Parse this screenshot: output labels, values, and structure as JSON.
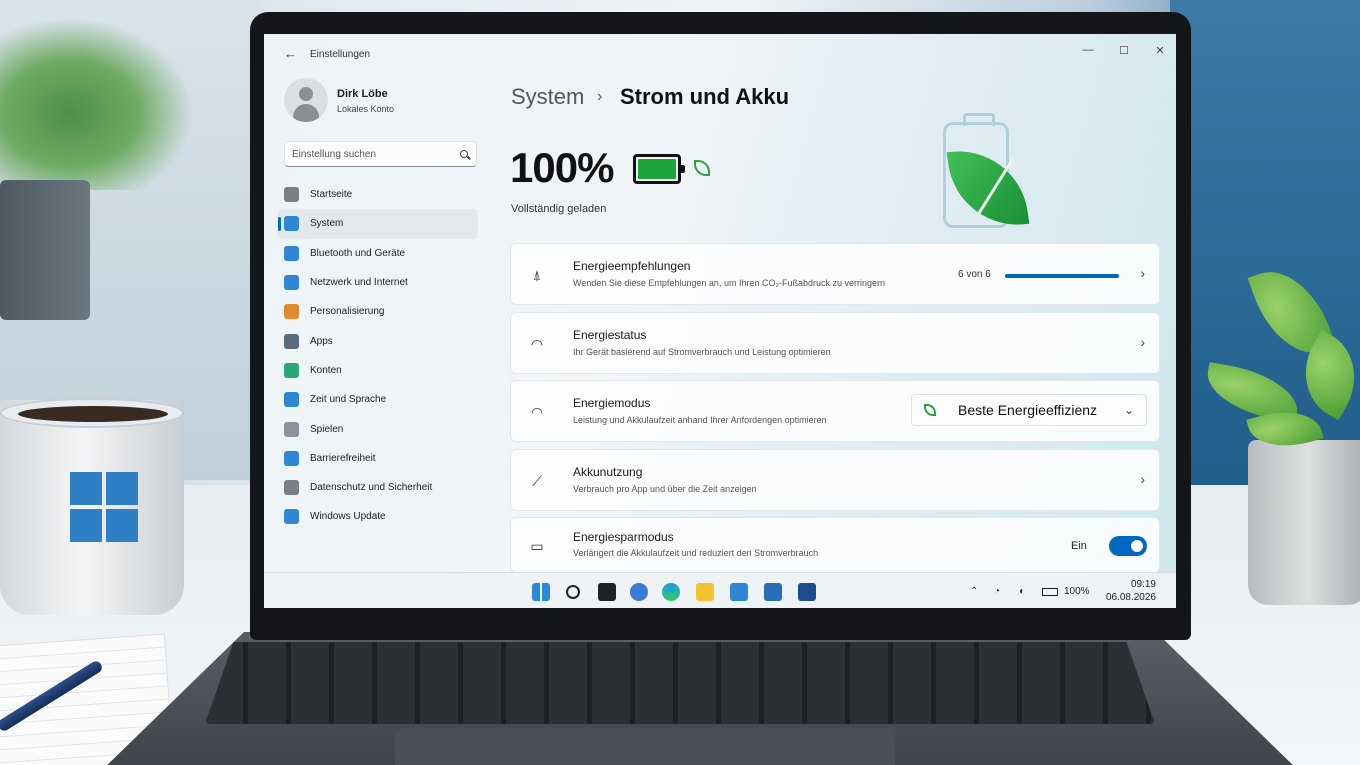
{
  "window": {
    "title": "Einstellungen",
    "back": "←",
    "controls": [
      "—",
      "☐",
      "✕"
    ]
  },
  "user": {
    "name": "Dirk Löbe",
    "account": "Lokales Konto"
  },
  "search": {
    "placeholder": "Einstellung suchen"
  },
  "nav": [
    {
      "label": "Startseite",
      "icon": "home-icon",
      "color": "#7a7f85",
      "active": false
    },
    {
      "label": "System",
      "icon": "system-icon",
      "color": "#2f87d4",
      "active": true
    },
    {
      "label": "Bluetooth und Geräte",
      "icon": "bluetooth-icon",
      "color": "#2f87d4",
      "active": false
    },
    {
      "label": "Netzwerk und Internet",
      "icon": "wifi-icon",
      "color": "#2f87d4",
      "active": false
    },
    {
      "label": "Personalisierung",
      "icon": "brush-icon",
      "color": "#e08a2e",
      "active": false
    },
    {
      "label": "Apps",
      "icon": "apps-icon",
      "color": "#5b6b7e",
      "active": false
    },
    {
      "label": "Konten",
      "icon": "person-icon",
      "color": "#2ba776",
      "active": false
    },
    {
      "label": "Zeit und Sprache",
      "icon": "globe-icon",
      "color": "#2f87d4",
      "active": false
    },
    {
      "label": "Spielen",
      "icon": "gamepad-icon",
      "color": "#8a929b",
      "active": false
    },
    {
      "label": "Barrierefreiheit",
      "icon": "accessibility-icon",
      "color": "#2f87d4",
      "active": false
    },
    {
      "label": "Datenschutz und Sicherheit",
      "icon": "shield-icon",
      "color": "#7a7f85",
      "active": false
    },
    {
      "label": "Windows Update",
      "icon": "update-icon",
      "color": "#2f87d4",
      "active": false
    }
  ],
  "breadcrumb": {
    "parent": "System",
    "separator": "›",
    "current": "Strom und Akku"
  },
  "battery": {
    "percent": "100%",
    "level": 1.0,
    "status": "Vollständig geladen",
    "color": "#1fa33b"
  },
  "cards": {
    "recommendations": {
      "title": "Energieempfehlungen",
      "subtitle": "Wenden Sie diese Empfehlungen an, um Ihren CO₂-Fußabdruck zu verringern",
      "progress_label": "6 von 6",
      "progress": 1.0
    },
    "status": {
      "title": "Energiestatus",
      "subtitle": "Ihr Gerät basierend auf Stromverbrauch und Leistung optimieren"
    },
    "mode": {
      "title": "Energiemodus",
      "subtitle": "Leistung und Akkulaufzeit anhand Ihrer Anfordengen optimieren",
      "selected": "Beste Energieeffizienz"
    },
    "usage": {
      "title": "Akkunutzung",
      "subtitle": "Verbrauch pro App und über die Zeit anzeigen"
    },
    "saver": {
      "title": "Energiesparmodus",
      "subtitle": "Verlängert die Akkulaufzeit und reduziert den Stromverbrauch",
      "state_label": "Ein",
      "enabled": true
    }
  },
  "taskbar": {
    "apps": [
      "start-icon",
      "search-icon",
      "terminal-icon",
      "chat-icon",
      "edge-icon",
      "explorer-icon",
      "store-icon",
      "photos-icon",
      "settings-icon"
    ],
    "tray": {
      "battery": "100%",
      "time": "09:19",
      "date": "06.08.2026"
    }
  },
  "accent": "#0067c0"
}
